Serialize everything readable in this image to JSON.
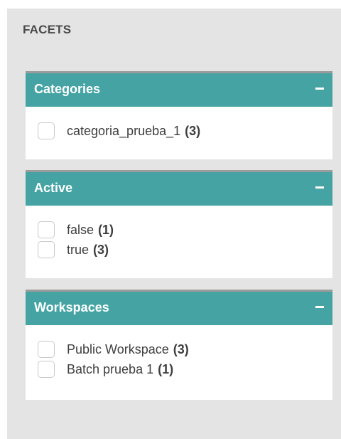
{
  "panel": {
    "title": "FACETS"
  },
  "facets": [
    {
      "label": "Categories",
      "collapse_icon": "minus-icon",
      "options": [
        {
          "label": "categoria_prueba_1",
          "count": "(3)",
          "checked": false
        }
      ]
    },
    {
      "label": "Active",
      "collapse_icon": "minus-icon",
      "options": [
        {
          "label": "false",
          "count": "(1)",
          "checked": false
        },
        {
          "label": "true",
          "count": "(3)",
          "checked": false
        }
      ]
    },
    {
      "label": "Workspaces",
      "collapse_icon": "minus-icon",
      "options": [
        {
          "label": "Public Workspace",
          "count": "(3)",
          "checked": false
        },
        {
          "label": "Batch prueba 1",
          "count": "(1)",
          "checked": false
        }
      ]
    }
  ],
  "colors": {
    "header_bg": "#45a3a4",
    "panel_bg": "#e4e4e4",
    "header_border": "#9b9b9b"
  }
}
